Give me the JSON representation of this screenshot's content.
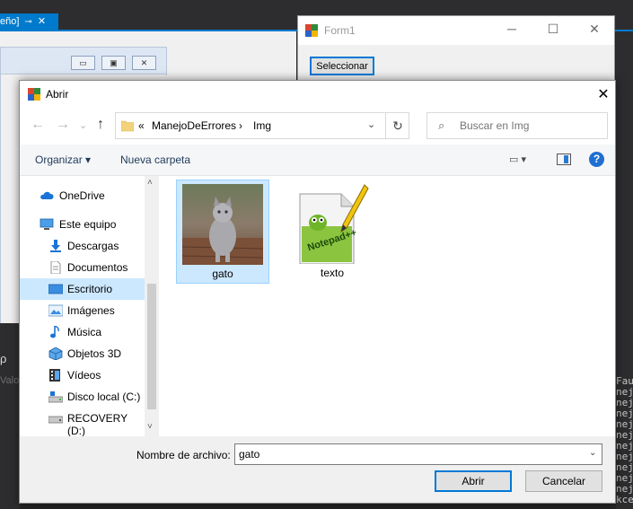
{
  "vs": {
    "tab_label": "eño]",
    "pin_glyph": "⊸",
    "close_glyph": "✕",
    "left_text": "Valo",
    "left_icon": "ρ",
    "output_lines": [
      "Fau",
      "nej",
      "nej",
      "nej",
      "nej",
      "nej",
      "nej",
      "nej",
      "nej",
      "nej",
      "nej",
      "kce"
    ]
  },
  "form1": {
    "title": "Form1",
    "minimize_glyph": "─",
    "maximize_glyph": "☐",
    "close_glyph": "✕",
    "button_label": "Seleccionar"
  },
  "dialog": {
    "title": "Abrir",
    "close_glyph": "✕",
    "nav": {
      "back": "←",
      "forward": "→",
      "recent": "⌄",
      "up": "↑"
    },
    "address": {
      "prefix": "«",
      "segments": [
        "ManejoDeErrores",
        "Img"
      ],
      "separator": "›",
      "dropdown": "⌄",
      "refresh": "↻"
    },
    "search": {
      "icon": "⌕",
      "placeholder": "Buscar en Img"
    },
    "toolbar": {
      "organize": "Organizar ▾",
      "new_folder": "Nueva carpeta",
      "view": "▭ ▾",
      "help": "?"
    },
    "nav_items": [
      {
        "label": "OneDrive",
        "icon": "cloud-icon"
      },
      {
        "label": "Este equipo",
        "icon": "computer-icon"
      },
      {
        "label": "Descargas",
        "icon": "download-icon"
      },
      {
        "label": "Documentos",
        "icon": "document-icon"
      },
      {
        "label": "Escritorio",
        "icon": "desktop-icon"
      },
      {
        "label": "Imágenes",
        "icon": "pictures-icon"
      },
      {
        "label": "Música",
        "icon": "music-icon"
      },
      {
        "label": "Objetos 3D",
        "icon": "3d-objects-icon"
      },
      {
        "label": "Vídeos",
        "icon": "videos-icon"
      },
      {
        "label": "Disco local (C:)",
        "icon": "local-disk-icon"
      },
      {
        "label": "RECOVERY (D:)",
        "icon": "recovery-drive-icon"
      }
    ],
    "selected_nav_item": "Escritorio",
    "scroll": {
      "up": "˄",
      "down": "˅"
    },
    "files": [
      {
        "name": "gato",
        "icon": "cat-photo-thumbnail",
        "selected": true
      },
      {
        "name": "texto",
        "icon": "notepad-plus-plus-icon",
        "selected": false
      }
    ],
    "filename_label": "Nombre de archivo:",
    "filename_value": "gato",
    "filename_dropdown": "⌄",
    "open_button": "Abrir",
    "cancel_button": "Cancelar"
  },
  "colors": {
    "vs_accent": "#007acc",
    "selection": "#cce8ff",
    "button_focus": "#0078d7"
  }
}
